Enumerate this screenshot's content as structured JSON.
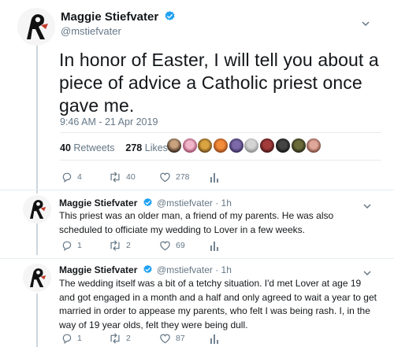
{
  "main": {
    "name": "Maggie Stiefvater",
    "handle": "@mstiefvater",
    "text": "In honor of Easter, I will tell you about a piece of advice a Catholic priest once gave me.",
    "timestamp": "9:46 AM - 21 Apr 2019",
    "retweets_count": "40",
    "retweets_label": "Retweets",
    "likes_count": "278",
    "likes_label": "Likes",
    "actions": {
      "replies": "4",
      "retweets": "40",
      "likes": "278"
    }
  },
  "replies": [
    {
      "name": "Maggie Stiefvater",
      "meta": "@mstiefvater · 1h",
      "text": "This priest was an older man, a friend of my parents. He was also scheduled to officiate my wedding to Lover in a few weeks.",
      "actions": {
        "replies": "1",
        "retweets": "2",
        "likes": "69"
      }
    },
    {
      "name": "Maggie Stiefvater",
      "meta": "@mstiefvater · 1h",
      "text": "The wedding itself was a bit of a tetchy situation. I'd met Lover at age 19 and got engaged in a month and a half and only agreed to wait a year to get married in order to appease my parents, who felt I was being rash. I, in the way of 19 year olds, felt they were being dull.",
      "actions": {
        "replies": "1",
        "retweets": "2",
        "likes": "87"
      }
    }
  ],
  "colors": {
    "verified": "#1da1f2",
    "secondary_text": "#657786",
    "divider": "#e6ecf0",
    "thread_line": "#ccd6dd"
  },
  "icons": [
    "avatar-logo",
    "verified-badge-icon",
    "chevron-down-icon",
    "reply-icon",
    "retweet-icon",
    "like-icon",
    "analytics-icon"
  ]
}
